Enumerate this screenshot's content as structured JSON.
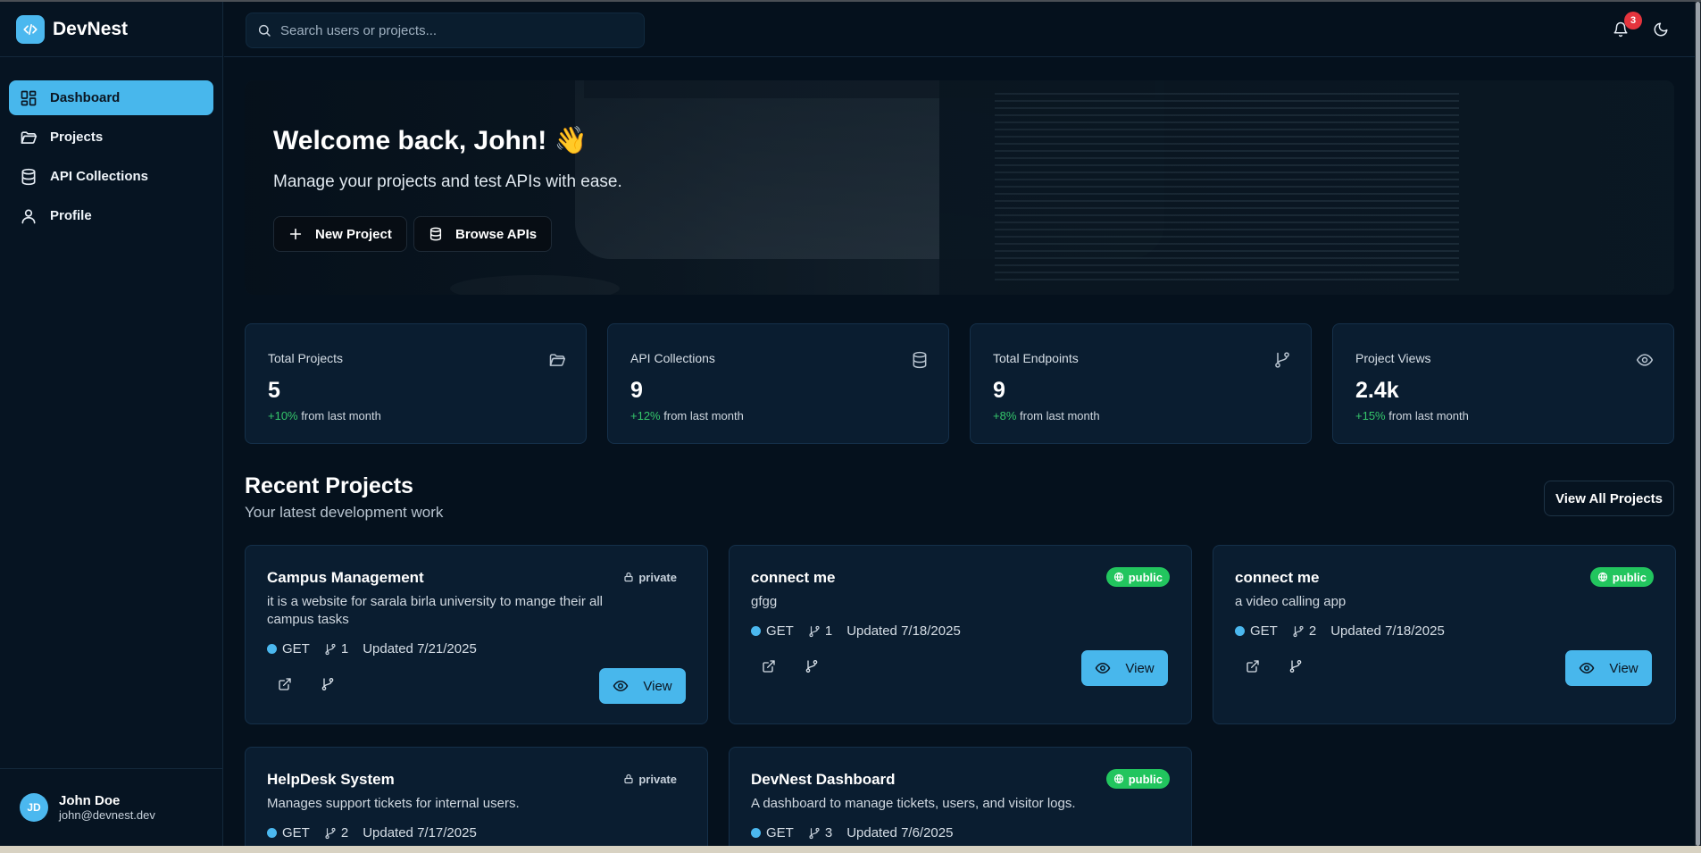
{
  "app": {
    "name": "DevNest"
  },
  "sidebar": {
    "items": [
      {
        "label": "Dashboard",
        "icon": "dashboard-icon",
        "active": true
      },
      {
        "label": "Projects",
        "icon": "folder-icon",
        "active": false
      },
      {
        "label": "API Collections",
        "icon": "database-icon",
        "active": false
      },
      {
        "label": "Profile",
        "icon": "user-icon",
        "active": false
      }
    ],
    "user": {
      "initials": "JD",
      "name": "John Doe",
      "email": "john@devnest.dev"
    }
  },
  "topbar": {
    "search_placeholder": "Search users or projects...",
    "notifications_count": "3"
  },
  "hero": {
    "title": "Welcome back, John! 👋",
    "subtitle": "Manage your projects and test APIs with ease.",
    "new_project_label": "New Project",
    "browse_apis_label": "Browse APIs"
  },
  "stats": [
    {
      "label": "Total Projects",
      "value": "5",
      "change": "+10%",
      "change_suffix": "from last month",
      "icon": "folder-icon"
    },
    {
      "label": "API Collections",
      "value": "9",
      "change": "+12%",
      "change_suffix": "from last month",
      "icon": "database-icon"
    },
    {
      "label": "Total Endpoints",
      "value": "9",
      "change": "+8%",
      "change_suffix": "from last month",
      "icon": "git-branch-icon"
    },
    {
      "label": "Project Views",
      "value": "2.4k",
      "change": "+15%",
      "change_suffix": "from last month",
      "icon": "eye-icon"
    }
  ],
  "recent": {
    "title": "Recent Projects",
    "subtitle": "Your latest development work",
    "view_all_label": "View All Projects",
    "projects": [
      {
        "name": "Campus Management",
        "description": "it is a website for sarala birla university to mange their all campus tasks",
        "visibility": "private",
        "method": "GET",
        "endpoints": "1",
        "updated": "Updated 7/21/2025",
        "view_label": "View"
      },
      {
        "name": "connect me",
        "description": "gfgg",
        "visibility": "public",
        "method": "GET",
        "endpoints": "1",
        "updated": "Updated 7/18/2025",
        "view_label": "View"
      },
      {
        "name": "connect me",
        "description": "a video calling app",
        "visibility": "public",
        "method": "GET",
        "endpoints": "2",
        "updated": "Updated 7/18/2025",
        "view_label": "View"
      },
      {
        "name": "HelpDesk System",
        "description": "Manages support tickets for internal users.",
        "visibility": "private",
        "method": "GET",
        "endpoints": "2",
        "updated": "Updated 7/17/2025"
      },
      {
        "name": "DevNest Dashboard",
        "description": "A dashboard to manage tickets, users, and visitor logs.",
        "visibility": "public",
        "method": "GET",
        "endpoints": "3",
        "updated": "Updated 7/6/2025"
      }
    ]
  },
  "colors": {
    "accent": "#48b7ec",
    "background": "#05111d",
    "card": "#0a1d30",
    "public_badge": "#22c55e",
    "notification_badge": "#e5343d",
    "positive_change": "#35c76b"
  }
}
